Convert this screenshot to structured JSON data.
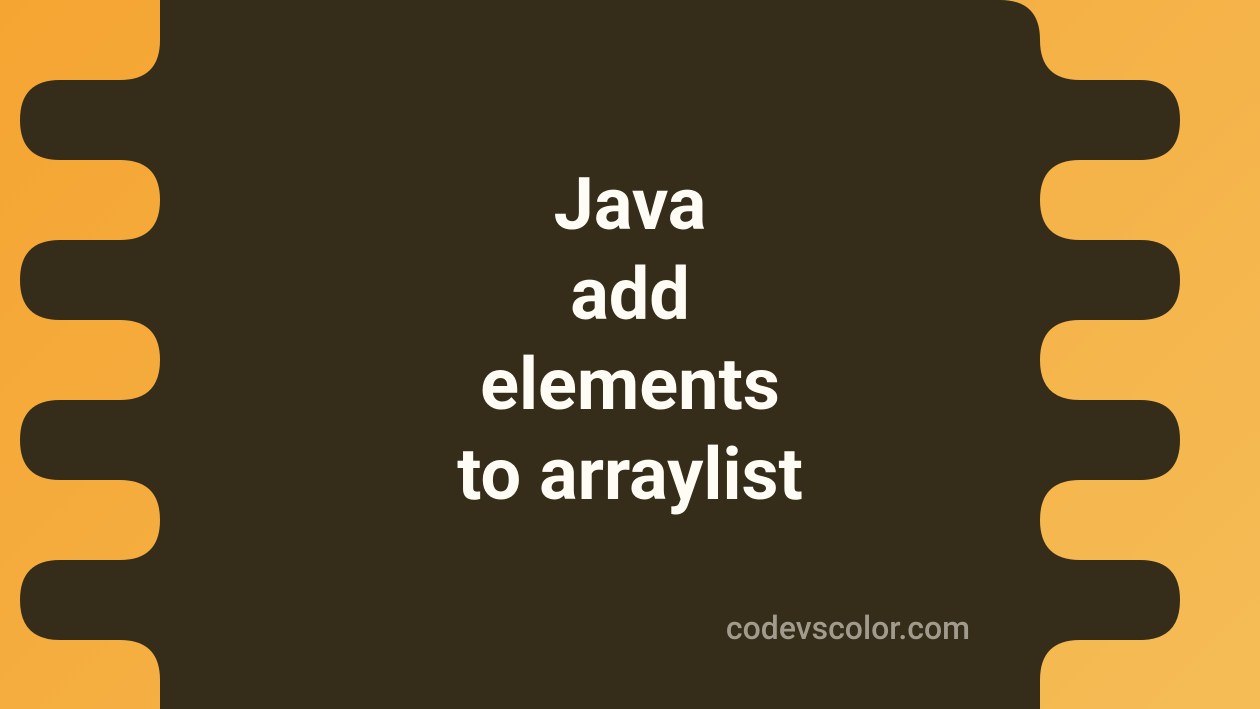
{
  "title": {
    "line1": "Java",
    "line2": "add",
    "line3": "elements",
    "line4": "to arraylist"
  },
  "watermark": "codevscolor.com",
  "colors": {
    "background_start": "#f5a532",
    "background_end": "#f5bc56",
    "blob": "#352d1a",
    "text": "#fffcf5",
    "watermark": "#a09b8c"
  }
}
